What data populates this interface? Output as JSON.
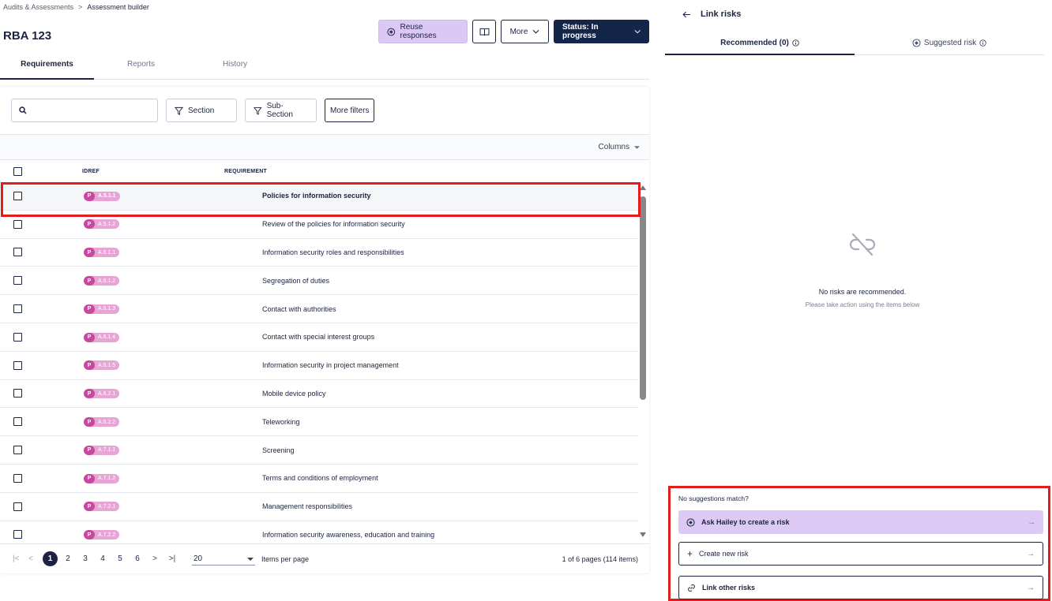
{
  "breadcrumb": {
    "parent": "Audits & Assessments",
    "separator": ">",
    "current": "Assessment builder"
  },
  "page": {
    "title": "RBA 123"
  },
  "toolbar": {
    "reuse_label": "Reuse responses",
    "more_label": "More",
    "status_label": "Status: In progress"
  },
  "tabs": [
    {
      "label": "Requirements",
      "active": true
    },
    {
      "label": "Reports",
      "active": false
    },
    {
      "label": "History",
      "active": false
    }
  ],
  "filters": {
    "search_placeholder": "",
    "section_label": "Section",
    "subsection_label": "Sub-Section",
    "more_filters_label": "More filters"
  },
  "grid": {
    "columns_label": "Columns",
    "headers": {
      "idref": "IDREF",
      "requirement": "REQUIREMENT"
    },
    "prefix": "P",
    "rows": [
      {
        "idref": "A.5.1.1",
        "requirement": "Policies for information security",
        "selected": true
      },
      {
        "idref": "A.5.1.2",
        "requirement": "Review of the policies for information security"
      },
      {
        "idref": "A.6.1.1",
        "requirement": "Information security roles and responsibilities"
      },
      {
        "idref": "A.6.1.2",
        "requirement": "Segregation of duties"
      },
      {
        "idref": "A.6.1.3",
        "requirement": "Contact with authorities"
      },
      {
        "idref": "A.6.1.4",
        "requirement": "Contact with special interest groups"
      },
      {
        "idref": "A.6.1.5",
        "requirement": "Information security in project management"
      },
      {
        "idref": "A.6.2.1",
        "requirement": "Mobile device policy"
      },
      {
        "idref": "A.6.2.2",
        "requirement": "Teleworking"
      },
      {
        "idref": "A.7.1.1",
        "requirement": "Screening"
      },
      {
        "idref": "A.7.1.2",
        "requirement": "Terms and conditions of employment"
      },
      {
        "idref": "A.7.2.1",
        "requirement": "Management responsibilities"
      },
      {
        "idref": "A.7.2.2",
        "requirement": "Information security awareness, education and training"
      }
    ]
  },
  "pagination": {
    "pages": [
      "1",
      "2",
      "3",
      "4",
      "5",
      "6"
    ],
    "current": "1",
    "per_page": "20",
    "per_page_label": "Items per page",
    "info": "1 of 6 pages (114 items)"
  },
  "panel": {
    "title": "Link risks",
    "tabs": {
      "recommended": "Recommended (0)",
      "suggested": "Suggested risk"
    },
    "empty_title": "No risks are recommended.",
    "empty_sub": "Please take action using the items below",
    "no_match": "No suggestions match?",
    "actions": {
      "hailey": "Ask Hailey to create a risk",
      "create": "Create new risk",
      "link": "Link other risks"
    }
  },
  "colors": {
    "navy": "#14254a",
    "accent_purple": "#dccaf4",
    "pill_pink": "#e7a5d5",
    "highlight_red": "#e01e1e"
  },
  "icons": [
    "search-icon",
    "filter-icon",
    "book-icon",
    "chevron-down-icon",
    "arrow-left-icon",
    "info-icon",
    "ai-icon",
    "link-off-icon",
    "plus-icon",
    "link-icon",
    "arrow-right-icon"
  ]
}
